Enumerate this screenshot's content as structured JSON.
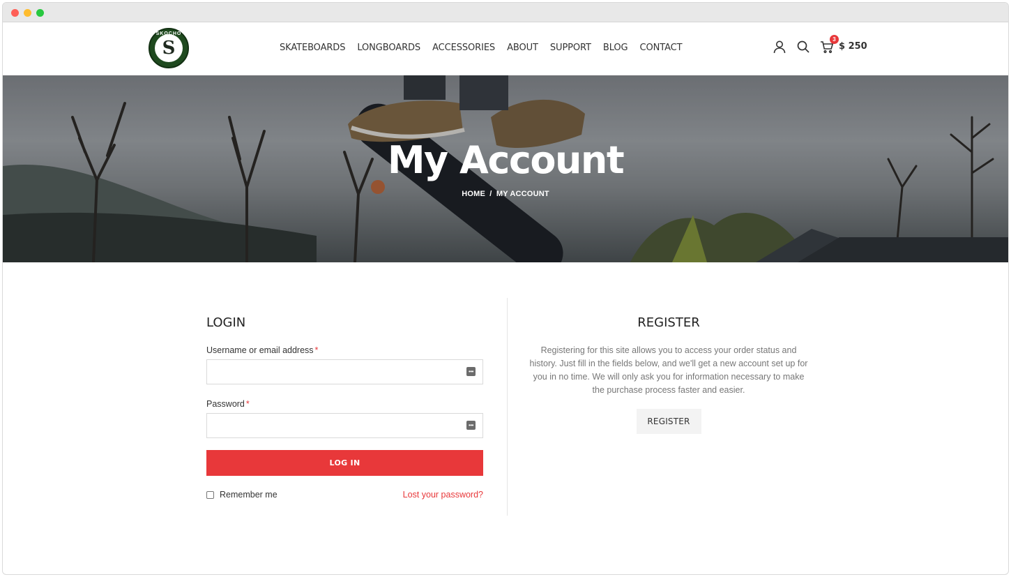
{
  "header": {
    "logo_text": "SKOCHO",
    "nav": [
      {
        "label": "SKATEBOARDS"
      },
      {
        "label": "LONGBOARDS"
      },
      {
        "label": "ACCESSORIES"
      },
      {
        "label": "ABOUT"
      },
      {
        "label": "SUPPORT"
      },
      {
        "label": "BLOG"
      },
      {
        "label": "CONTACT"
      }
    ],
    "icons": [
      "user-icon",
      "search-icon",
      "cart-icon"
    ],
    "cart_count": "3",
    "cart_total": "$ 250"
  },
  "hero": {
    "title": "My Account",
    "breadcrumb": {
      "home": "HOME",
      "separator": "/",
      "current": "MY ACCOUNT"
    }
  },
  "login": {
    "title": "LOGIN",
    "username_label": "Username or email address",
    "password_label": "Password",
    "required_mark": "*",
    "username_value": "",
    "password_value": "",
    "button_label": "LOG IN",
    "remember_label": "Remember me",
    "lost_password": "Lost your password?"
  },
  "register": {
    "title": "REGISTER",
    "text": "Registering for this site allows you to access your order status and history. Just fill in the fields below, and we'll get a new account set up for you in no time. We will only ask you for information necessary to make the purchase process faster and easier.",
    "button_label": "REGISTER"
  },
  "colors": {
    "accent": "#e8383a",
    "text": "#333333",
    "muted": "#777777"
  }
}
